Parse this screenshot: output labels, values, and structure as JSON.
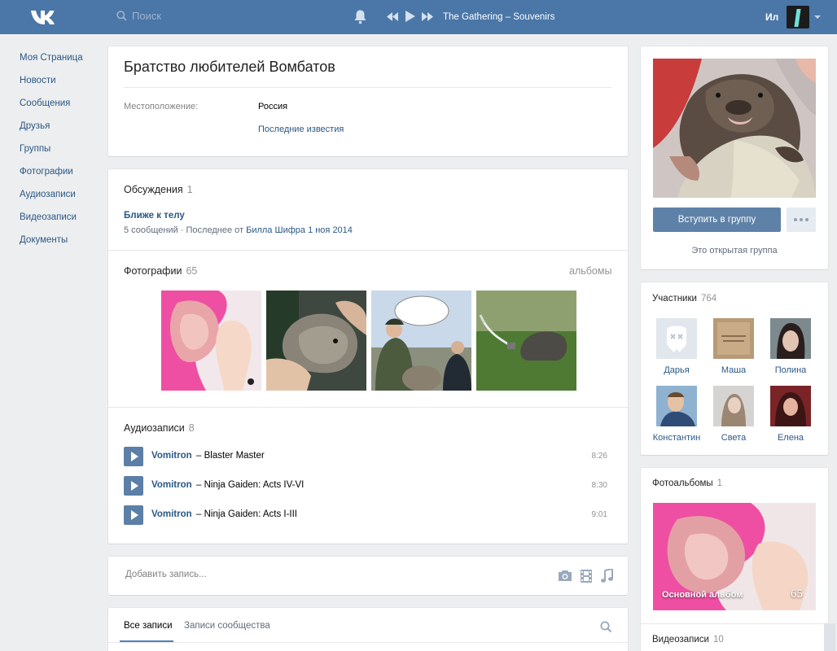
{
  "header": {
    "search_placeholder": "Поиск",
    "now_playing": "The Gathering – Souvenirs",
    "user_name": "Ил"
  },
  "leftnav": [
    {
      "label": "Моя Страница"
    },
    {
      "label": "Новости"
    },
    {
      "label": "Сообщения"
    },
    {
      "label": "Друзья"
    },
    {
      "label": "Группы"
    },
    {
      "label": "Фотографии"
    },
    {
      "label": "Аудиозаписи"
    },
    {
      "label": "Видеозаписи"
    },
    {
      "label": "Документы"
    }
  ],
  "group": {
    "title": "Братство любителей Вомбатов",
    "location_label": "Местоположение:",
    "location_value": "Россия",
    "news_link": "Последние известия"
  },
  "discussions": {
    "title": "Обсуждения",
    "count": "1",
    "topic_title": "Ближе к телу",
    "topic_meta": "5 сообщений · Последнее от",
    "topic_author": "Билла Шифра",
    "topic_date": "1 ноя 2014"
  },
  "photos": {
    "title": "Фотографии",
    "count": "65",
    "albums_link": "альбомы"
  },
  "audio": {
    "title": "Аудиозаписи",
    "count": "8",
    "tracks": [
      {
        "artist": "Vomitron",
        "song": "– Blaster Master",
        "duration": "8:26"
      },
      {
        "artist": "Vomitron",
        "song": "– Ninja Gaiden: Acts IV-VI",
        "duration": "8:30"
      },
      {
        "artist": "Vomitron",
        "song": "– Ninja Gaiden: Acts I-III",
        "duration": "9:01"
      }
    ]
  },
  "post_box": {
    "placeholder": "Добавить запись..."
  },
  "wall_tabs": {
    "all": "Все записи",
    "community": "Записи сообщества"
  },
  "sidebar": {
    "join_button": "Вступить в группу",
    "open_group": "Это открытая группа",
    "members_title": "Участники",
    "members_count": "764",
    "members": [
      {
        "name": "Дарья"
      },
      {
        "name": "Маша"
      },
      {
        "name": "Полина"
      },
      {
        "name": "Константин"
      },
      {
        "name": "Света"
      },
      {
        "name": "Елена"
      }
    ],
    "albums_title": "Фотоальбомы",
    "albums_count": "1",
    "album_name": "Основной альбом",
    "album_photo_count": "65",
    "videos_title": "Видеозаписи",
    "videos_count": "10"
  },
  "colors": {
    "header_bg": "#4a76a8",
    "link": "#2a5885",
    "page_bg": "#edeef0",
    "button": "#5e81a8"
  },
  "icons": [
    "vk-logo-icon",
    "search-icon",
    "bell-icon",
    "prev-track-icon",
    "play-icon",
    "next-track-icon",
    "camera-icon",
    "video-icon",
    "music-icon"
  ]
}
